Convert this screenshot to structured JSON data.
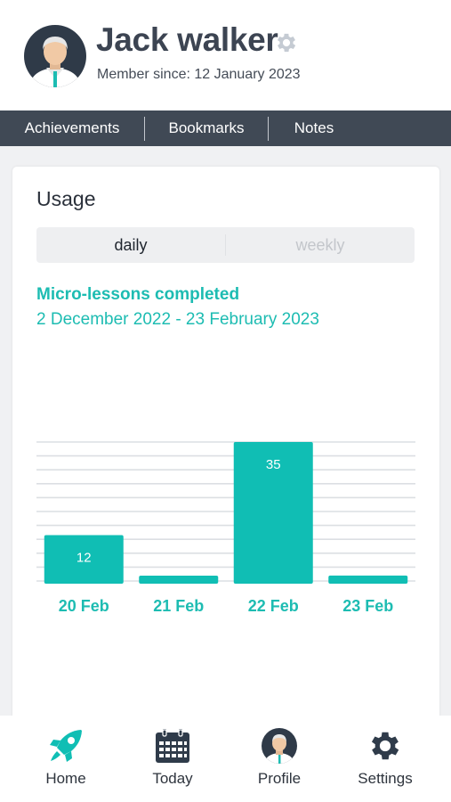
{
  "user": {
    "name": "Jack walker",
    "member_since": "Member since: 12 January 2023"
  },
  "tabs": [
    {
      "label": "Achievements"
    },
    {
      "label": "Bookmarks"
    },
    {
      "label": "Notes"
    }
  ],
  "usage": {
    "title": "Usage",
    "toggle": {
      "daily": "daily",
      "weekly": "weekly",
      "selected": "daily"
    },
    "metric_title": "Micro-lessons completed",
    "date_range": "2 December 2022 - 23 February 2023"
  },
  "chart_data": {
    "type": "bar",
    "categories": [
      "20 Feb",
      "21 Feb",
      "22 Feb",
      "23 Feb"
    ],
    "values": [
      12,
      1,
      35,
      2
    ],
    "data_labels": [
      "12",
      "",
      "35",
      ""
    ],
    "ylim": [
      0,
      35
    ],
    "grid": true,
    "bar_color": "#10beb4",
    "label_color": "#1dbcb2"
  },
  "nav": [
    {
      "label": "Home",
      "icon": "rocket-icon"
    },
    {
      "label": "Today",
      "icon": "calendar-icon"
    },
    {
      "label": "Profile",
      "icon": "avatar-icon"
    },
    {
      "label": "Settings",
      "icon": "gear-icon"
    }
  ],
  "colors": {
    "accent": "#10beb4",
    "tabbar": "#404955",
    "nav_dark": "#2f3b4a"
  }
}
